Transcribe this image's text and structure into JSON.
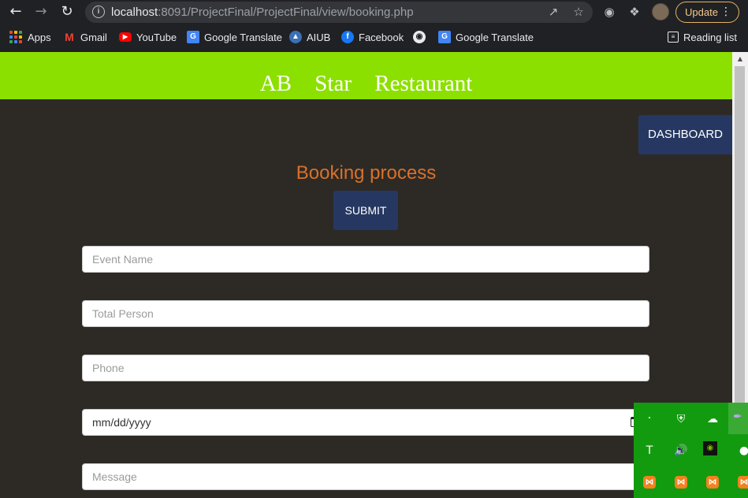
{
  "browser": {
    "url_host": "localhost",
    "url_rest": ":8091/ProjectFinal/ProjectFinal/view/booking.php",
    "update_label": "Update",
    "bookmarks": [
      {
        "label": "Apps",
        "icon": "apps-grid-icon"
      },
      {
        "label": "Gmail",
        "icon": "gmail-icon",
        "color": "#ea4335"
      },
      {
        "label": "YouTube",
        "icon": "youtube-icon",
        "color": "#ff0000"
      },
      {
        "label": "Google Translate",
        "icon": "google-translate-icon",
        "color": "#4285f4"
      },
      {
        "label": "AIUB",
        "icon": "aiub-shield-icon",
        "color": "#3b6fb6"
      },
      {
        "label": "Facebook",
        "icon": "facebook-icon",
        "color": "#1877f2"
      },
      {
        "label": "",
        "icon": "globe-icon"
      },
      {
        "label": "Google Translate",
        "icon": "google-translate-icon",
        "color": "#4285f4"
      }
    ],
    "reading_list": "Reading list"
  },
  "site": {
    "brand": "AB Star Restaurant",
    "dashboard_label": "DASHBOARD",
    "heading": "Booking process",
    "submit_label": "SUBMIT"
  },
  "form": {
    "event_name_placeholder": "Event Name",
    "total_person_placeholder": "Total Person",
    "phone_placeholder": "Phone",
    "date_placeholder": "mm/dd/yyyy",
    "message_placeholder": "Message"
  },
  "colors": {
    "header_green": "#8ce000",
    "page_bg": "#2d2a26",
    "button_navy": "#263861",
    "heading_orange": "#d9712a",
    "tray_green": "#139b0f"
  }
}
